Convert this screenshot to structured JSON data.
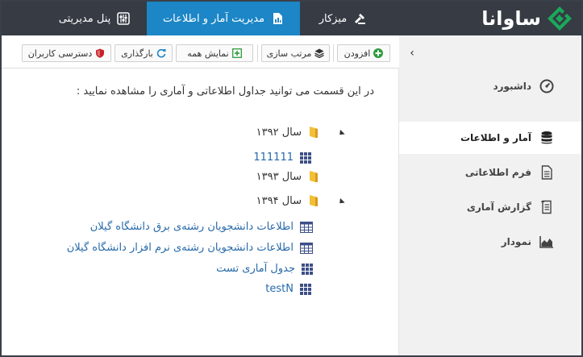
{
  "brand": {
    "name": "ساوانا"
  },
  "topnav": {
    "desk": "میزکار",
    "stats": "مدیریت آمار و اطلاعات",
    "admin": "پنل مدیریتی"
  },
  "toolbar": {
    "add": "افزودن",
    "sort": "مرتب سازی",
    "show_all": "نمایش همه",
    "reload": "بارگذاری",
    "access": "دسترسی کاربران"
  },
  "intro": "در این قسمت می توانید جداول اطلاعاتی و آماری را مشاهده نمایید :",
  "tree": {
    "y1392": "سال ۱۳۹۲",
    "t111111": "111111",
    "y1393": "سال ۱۳۹۳",
    "y1394": "سال ۱۳۹۴",
    "t_elec": "اطلاعات دانشجویان رشته‌ی برق دانشگاه گیلان",
    "t_soft": "اطلاعات دانشجویان رشته‌ی نرم افزار دانشگاه گیلان",
    "t_test": "جدول آماری تست",
    "t_testN": "testN"
  },
  "sidebar": {
    "items": [
      {
        "label": "داشبورد",
        "icon": "gauge-icon"
      },
      {
        "label": "آمار و اطلاعات",
        "icon": "database-icon",
        "active": true
      },
      {
        "label": "فرم اطلاعاتی",
        "icon": "document-icon"
      },
      {
        "label": "گزارش آماری",
        "icon": "report-icon"
      },
      {
        "label": "نمودار",
        "icon": "area-chart-icon"
      }
    ]
  },
  "colors": {
    "topbar": "#363b44",
    "accent": "#1c86c6",
    "logo_green": "#1aa85a",
    "link": "#2769a9",
    "folder": "#f2c037"
  }
}
